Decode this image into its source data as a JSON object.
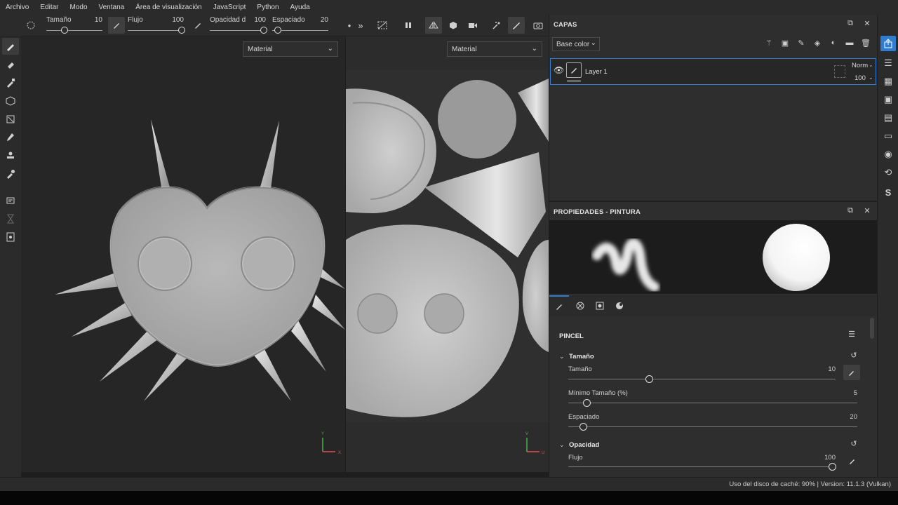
{
  "menu": [
    "Archivo",
    "Editar",
    "Modo",
    "Ventana",
    "Área de visualización",
    "JavaScript",
    "Python",
    "Ayuda"
  ],
  "toolbar": {
    "size_label": "Tamaño",
    "size_value": "10",
    "flow_label": "Flujo",
    "flow_value": "100",
    "opacity_label": "Opacidad d",
    "opacity_value": "100",
    "spacing_label": "Espaciado",
    "spacing_value": "20"
  },
  "viewport3d": {
    "material_select": "Material"
  },
  "viewport2d": {
    "material_select": "Material"
  },
  "layers": {
    "title": "CAPAS",
    "channel": "Base color",
    "layer_name": "Layer 1",
    "blend_mode": "Norm",
    "opacity": "100"
  },
  "properties": {
    "title": "PROPIEDADES - PINTURA",
    "brush_section": "PINCEL",
    "size_group": "Tamaño",
    "size_label": "Tamaño",
    "size_value": "10",
    "min_size_label": "Mínimo Tamaño (%)",
    "min_size_value": "5",
    "spacing_label": "Espaciado",
    "spacing_value": "20",
    "opacity_group": "Opacidad",
    "flow_label": "Flujo",
    "flow_value": "100"
  },
  "status": {
    "text": "Uso del disco de caché:    90% | Version: 11.1.3 (Vulkan)"
  },
  "colors": {
    "accent": "#2f7dd1",
    "panel": "#2e2e2e",
    "viewport": "#262626"
  }
}
